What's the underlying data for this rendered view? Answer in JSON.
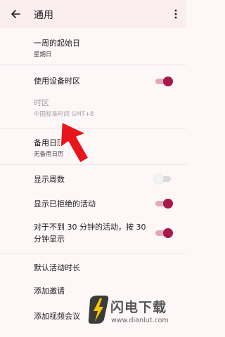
{
  "appbar": {
    "title": "通用",
    "back_icon": "arrow-back-icon",
    "more_icon": "more-vert-icon"
  },
  "settings": {
    "week_start": {
      "title": "一周的起始日",
      "value": "星期日"
    },
    "device_timezone": {
      "title": "使用设备时区",
      "enabled": true
    },
    "timezone": {
      "title": "时区",
      "value": "中国标准时间  GMT+8"
    },
    "alternate_calendar": {
      "title": "备用日历",
      "value": "无备用日历"
    },
    "show_week_number": {
      "title": "显示周数",
      "enabled": false
    },
    "show_declined": {
      "title": "显示已拒绝的活动",
      "enabled": true
    },
    "short_events": {
      "title": "对于不到 30 分钟的活动，按 30 分钟显示",
      "enabled": true
    },
    "default_duration": {
      "title": "默认活动时长"
    },
    "add_invites": {
      "title": "添加邀请"
    },
    "add_video": {
      "title": "添加视频会议"
    }
  },
  "watermark": {
    "name": "闪电下载",
    "url": "www.dianlut.com"
  },
  "colors": {
    "accent": "#a8184b",
    "appbar_bg": "#fbeef0",
    "page_bg": "#fdf7f8",
    "arrow": "#e8161c"
  }
}
